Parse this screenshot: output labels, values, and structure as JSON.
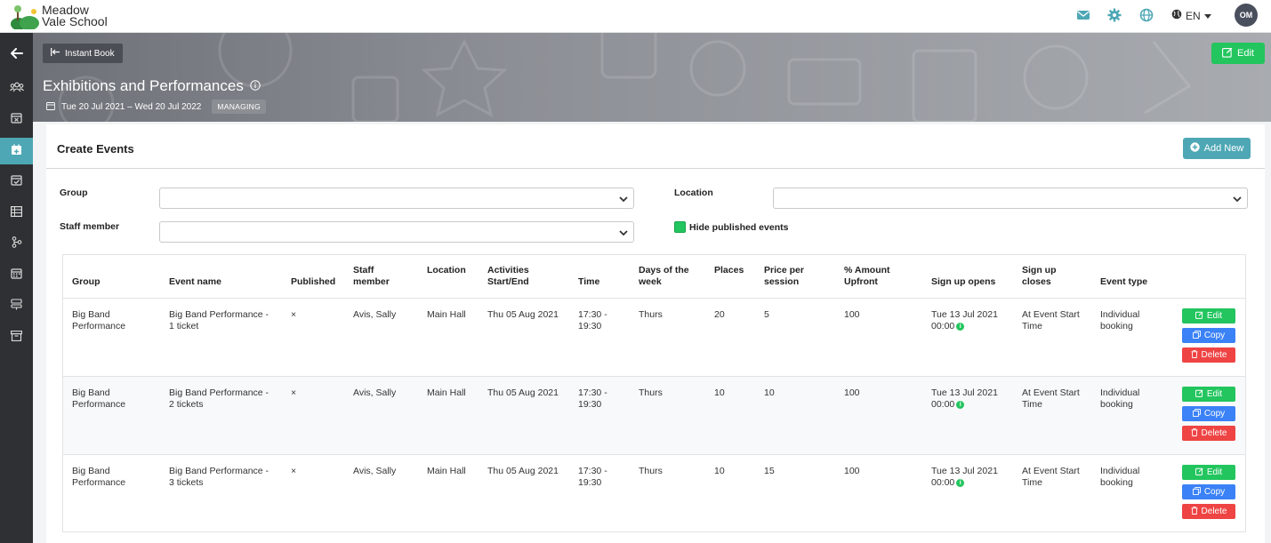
{
  "app": {
    "logo_line1": "Meadow",
    "logo_line2": "Vale School",
    "language": "EN",
    "avatar_initials": "OM"
  },
  "hero": {
    "instant_book_label": "Instant Book",
    "edit_label": "Edit",
    "title": "Exhibitions and Performances",
    "date_range": "Tue 20 Jul 2021 – Wed 20 Jul 2022",
    "badge": "MANAGING"
  },
  "section": {
    "title": "Create Events",
    "add_new_label": "Add New"
  },
  "filters": {
    "group_label": "Group",
    "group_value": "",
    "location_label": "Location",
    "location_value": "",
    "staff_label": "Staff member",
    "staff_value": "",
    "hide_published_label": "Hide published events",
    "hide_published_checked": true
  },
  "table": {
    "headers": {
      "group": "Group",
      "event_name": "Event name",
      "published": "Published",
      "staff_1": "Staff",
      "staff_2": "member",
      "location": "Location",
      "activities_1": "Activities",
      "activities_2": "Start/End",
      "time": "Time",
      "days_1": "Days of the",
      "days_2": "week",
      "places": "Places",
      "price_1": "Price per",
      "price_2": "session",
      "amount_1": "% Amount",
      "amount_2": "Upfront",
      "opens": "Sign up opens",
      "closes_1": "Sign up",
      "closes_2": "closes",
      "type": "Event type"
    },
    "rows": [
      {
        "group_1": "Big Band",
        "group_2": "Performance",
        "name_1": "Big Band Performance -",
        "name_2": "1 ticket",
        "published": "×",
        "staff": "Avis, Sally",
        "location": "Main Hall",
        "start_end": "Thu 05 Aug 2021",
        "time_1": "17:30 -",
        "time_2": "19:30",
        "days": "Thurs",
        "places": "20",
        "price": "5",
        "upfront": "100",
        "opens_1": "Tue 13 Jul 2021",
        "opens_2": "00:00",
        "closes_1": "At Event Start",
        "closes_2": "Time",
        "type_1": "Individual",
        "type_2": "booking",
        "edit": "Edit",
        "copy": "Copy",
        "delete": "Delete"
      },
      {
        "group_1": "Big Band",
        "group_2": "Performance",
        "name_1": "Big Band Performance -",
        "name_2": "2 tickets",
        "published": "×",
        "staff": "Avis, Sally",
        "location": "Main Hall",
        "start_end": "Thu 05 Aug 2021",
        "time_1": "17:30 -",
        "time_2": "19:30",
        "days": "Thurs",
        "places": "10",
        "price": "10",
        "upfront": "100",
        "opens_1": "Tue 13 Jul 2021",
        "opens_2": "00:00",
        "closes_1": "At Event Start",
        "closes_2": "Time",
        "type_1": "Individual",
        "type_2": "booking",
        "edit": "Edit",
        "copy": "Copy",
        "delete": "Delete"
      },
      {
        "group_1": "Big Band",
        "group_2": "Performance",
        "name_1": "Big Band Performance -",
        "name_2": "3 tickets",
        "published": "×",
        "staff": "Avis, Sally",
        "location": "Main Hall",
        "start_end": "Thu 05 Aug 2021",
        "time_1": "17:30 -",
        "time_2": "19:30",
        "days": "Thurs",
        "places": "10",
        "price": "15",
        "upfront": "100",
        "opens_1": "Tue 13 Jul 2021",
        "opens_2": "00:00",
        "closes_1": "At Event Start",
        "closes_2": "Time",
        "type_1": "Individual",
        "type_2": "booking",
        "edit": "Edit",
        "copy": "Copy",
        "delete": "Delete"
      }
    ]
  },
  "colors": {
    "accent_teal": "#4ea7b5",
    "success_green": "#22c55e",
    "copy_blue": "#3b82f6",
    "delete_red": "#ef4444",
    "sidebar": "#2f3033"
  },
  "icons": {
    "top": [
      "mail-icon",
      "gear-icon",
      "globe-network-icon",
      "globe-language-icon"
    ],
    "sidebar": [
      "back-arrow-icon",
      "users-icon",
      "calendar-x-icon",
      "calendar-add-icon",
      "calendar-check-icon",
      "table-icon",
      "hierarchy-icon",
      "calendar-grid-icon",
      "stack-icon",
      "archive-icon"
    ]
  }
}
